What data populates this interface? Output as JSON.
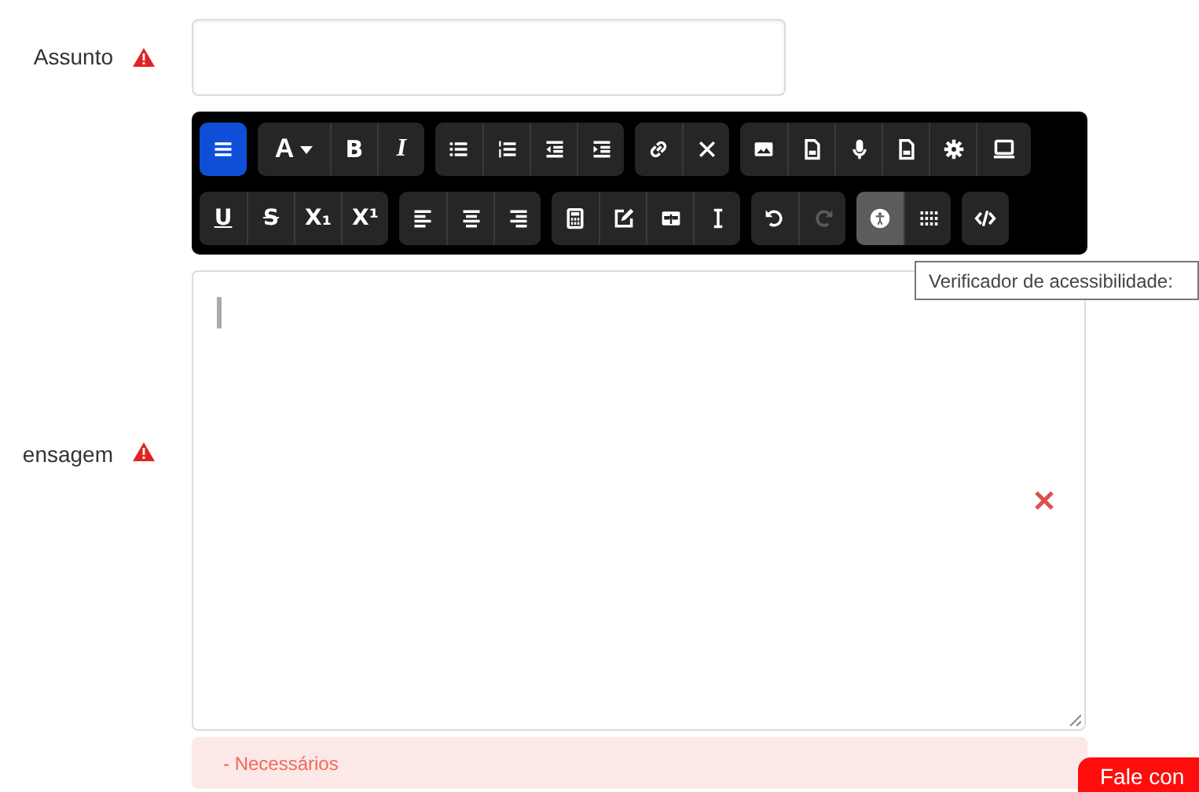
{
  "subject": {
    "label": "Assunto",
    "required": true
  },
  "message": {
    "label": "ensagem",
    "required": true,
    "error": "- Necessários"
  },
  "toolbar_rows": [
    [
      [
        {
          "kind": "menu",
          "selected": true,
          "disabled": false
        }
      ],
      [
        {
          "kind": "font",
          "label": "A",
          "selected": false,
          "disabled": false
        },
        {
          "kind": "bold",
          "label": "B",
          "selected": false,
          "disabled": false
        },
        {
          "kind": "italic",
          "label": "I",
          "selected": false,
          "disabled": false
        }
      ],
      [
        {
          "kind": "bullets",
          "selected": false,
          "disabled": false
        },
        {
          "kind": "numbers",
          "selected": false,
          "disabled": false
        },
        {
          "kind": "outdent",
          "selected": false,
          "disabled": false
        },
        {
          "kind": "indent",
          "selected": false,
          "disabled": false
        }
      ],
      [
        {
          "kind": "link",
          "selected": false,
          "disabled": false
        },
        {
          "kind": "unlink",
          "selected": false,
          "disabled": false
        }
      ],
      [
        {
          "kind": "image",
          "selected": false,
          "disabled": false
        },
        {
          "kind": "file",
          "selected": false,
          "disabled": false
        },
        {
          "kind": "mic",
          "selected": false,
          "disabled": false
        },
        {
          "kind": "file",
          "selected": false,
          "disabled": false
        },
        {
          "kind": "gear",
          "selected": false,
          "disabled": false
        },
        {
          "kind": "screen",
          "selected": false,
          "disabled": false
        }
      ]
    ],
    [
      [
        {
          "kind": "underline",
          "label": "U",
          "selected": false,
          "disabled": false
        },
        {
          "kind": "strike",
          "label": "S",
          "selected": false,
          "disabled": false
        },
        {
          "kind": "sub",
          "label": "X",
          "mark": "₁",
          "selected": false,
          "disabled": false
        },
        {
          "kind": "sup",
          "label": "X",
          "mark": "¹",
          "selected": false,
          "disabled": false
        }
      ],
      [
        {
          "kind": "left",
          "selected": false,
          "disabled": false
        },
        {
          "kind": "center",
          "selected": false,
          "disabled": false
        },
        {
          "kind": "right",
          "selected": false,
          "disabled": false
        }
      ],
      [
        {
          "kind": "calc",
          "selected": false,
          "disabled": false
        },
        {
          "kind": "edit",
          "selected": false,
          "disabled": false
        },
        {
          "kind": "table",
          "selected": false,
          "disabled": false
        },
        {
          "kind": "cursor",
          "selected": false,
          "disabled": false
        }
      ],
      [
        {
          "kind": "undo",
          "selected": false,
          "disabled": false
        },
        {
          "kind": "redo",
          "selected": false,
          "disabled": true
        }
      ],
      [
        {
          "kind": "access",
          "selected": true,
          "disabled": false
        },
        {
          "kind": "grid",
          "selected": false,
          "disabled": false
        }
      ],
      [
        {
          "kind": "code",
          "selected": false,
          "disabled": false
        }
      ]
    ]
  ],
  "tooltip": "Verificador de acessibilidade:",
  "contact_button": "Fale con"
}
